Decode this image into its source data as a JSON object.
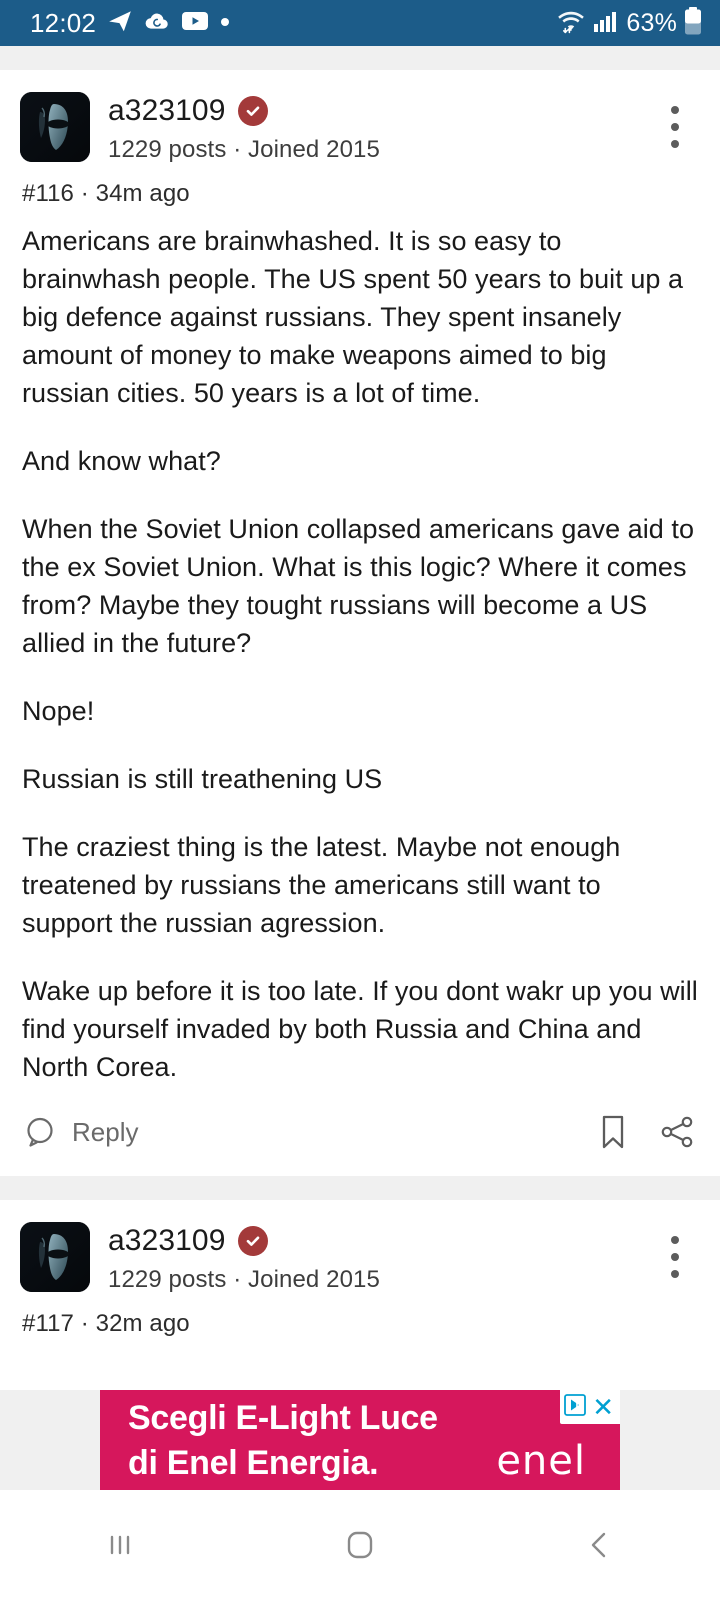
{
  "status_bar": {
    "time": "12:02",
    "battery_percent": "63%",
    "left_icons": [
      "telegram-icon",
      "cloud-sync-icon",
      "youtube-icon",
      "dot-icon"
    ],
    "right_icons": [
      "wifi-icon",
      "signal-bars-icon",
      "battery-icon"
    ],
    "background_color": "#1c5c89",
    "foreground_color": "#ffffff"
  },
  "posts": [
    {
      "username": "a323109",
      "verified": true,
      "verified_color": "#a33a3a",
      "meta": "1229 posts · Joined 2015",
      "post_id_line": "#116 · 34m ago",
      "paragraphs": [
        "Americans are brainwhashed. It is so easy to brainwhash people. The US spent 50 years to buit up a big defence against russians. They spent insanely amount of money to make weapons aimed to big russian cities. 50 years is a lot of time.",
        "And know what?",
        "When the Soviet Union collapsed americans gave aid to the ex Soviet Union. What is this logic? Where it comes from? Maybe they tought russians will become a US allied in the future?",
        "Nope!",
        "Russian is still treathening US",
        "The craziest thing is the latest. Maybe not enough treatened by russians the americans still want to support the russian agression.",
        "Wake up before it is too late. If you dont wakr up you will find yourself invaded by both Russia and China and North Corea."
      ],
      "actions": {
        "reply_label": "Reply",
        "reply_icon": "comment-bubble-icon",
        "bookmark_icon": "bookmark-icon",
        "share_icon": "share-icon"
      },
      "menu_icon": "kebab-menu-icon"
    },
    {
      "username": "a323109",
      "verified": true,
      "verified_color": "#a33a3a",
      "meta": "1229 posts · Joined 2015",
      "post_id_line": "#117 · 32m ago",
      "menu_icon": "kebab-menu-icon"
    }
  ],
  "ad": {
    "line1": "Scegli E-Light Luce",
    "line2": "di Enel Energia.",
    "brand": "enel",
    "background_color": "#d6175c",
    "close_label": "✕",
    "adchoices_icon": "adchoices-icon",
    "close_icon": "close-icon"
  },
  "nav_bar": {
    "recents_icon": "recents-icon",
    "home_icon": "home-icon",
    "back_icon": "back-icon"
  }
}
